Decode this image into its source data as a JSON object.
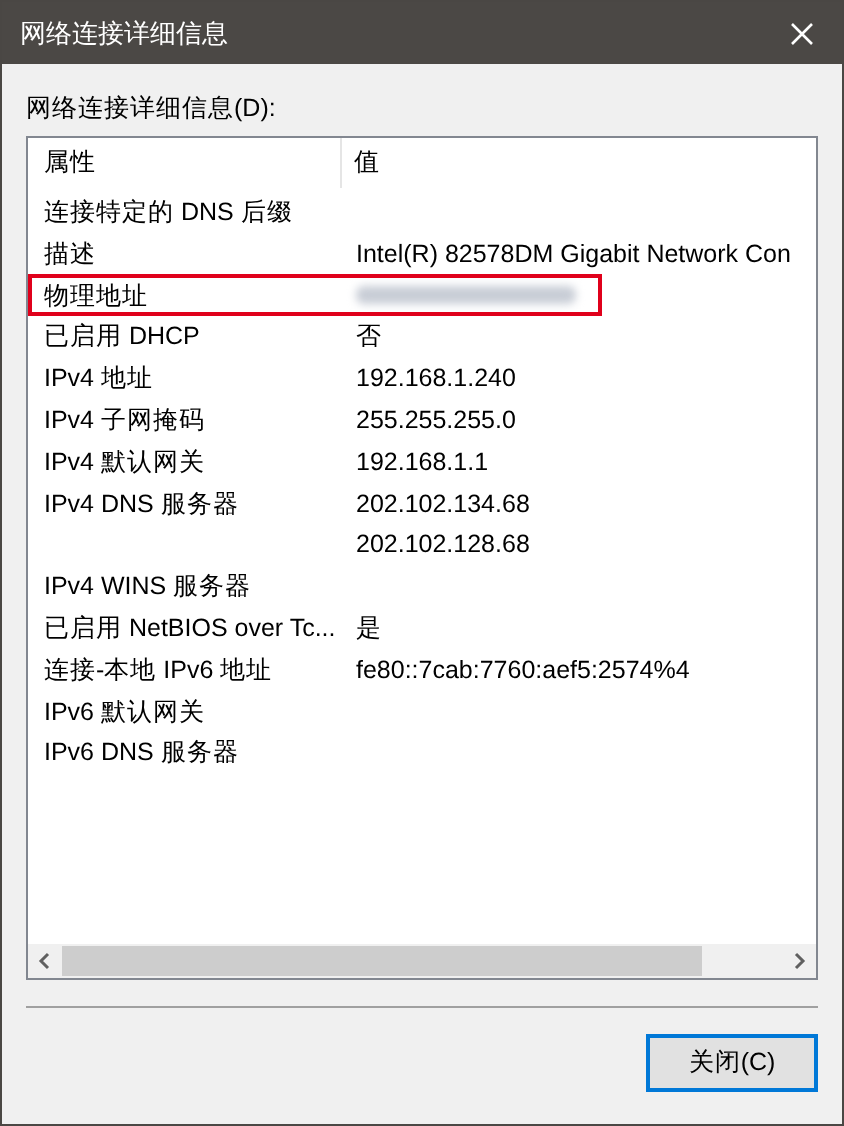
{
  "window": {
    "title": "网络连接详细信息"
  },
  "list_label": "网络连接详细信息(D):",
  "table": {
    "columns": [
      "属性",
      "值"
    ],
    "rows": [
      {
        "property": "连接特定的 DNS 后缀",
        "value": ""
      },
      {
        "property": "描述",
        "value": "Intel(R) 82578DM Gigabit Network Con"
      },
      {
        "property": "物理地址",
        "value": "",
        "redacted": true,
        "highlighted": true
      },
      {
        "property": "已启用 DHCP",
        "value": "否"
      },
      {
        "property": "IPv4 地址",
        "value": "192.168.1.240"
      },
      {
        "property": "IPv4 子网掩码",
        "value": "255.255.255.0"
      },
      {
        "property": "IPv4 默认网关",
        "value": "192.168.1.1"
      },
      {
        "property": "IPv4 DNS 服务器",
        "value": "202.102.134.68"
      },
      {
        "property": "",
        "value": "202.102.128.68"
      },
      {
        "property": "IPv4 WINS 服务器",
        "value": ""
      },
      {
        "property": "已启用 NetBIOS over Tc...",
        "value": "是"
      },
      {
        "property": "连接-本地 IPv6 地址",
        "value": "fe80::7cab:7760:aef5:2574%4"
      },
      {
        "property": "IPv6 默认网关",
        "value": ""
      },
      {
        "property": "IPv6 DNS 服务器",
        "value": ""
      }
    ]
  },
  "buttons": [
    {
      "label": "关闭(C)",
      "default": true
    }
  ]
}
